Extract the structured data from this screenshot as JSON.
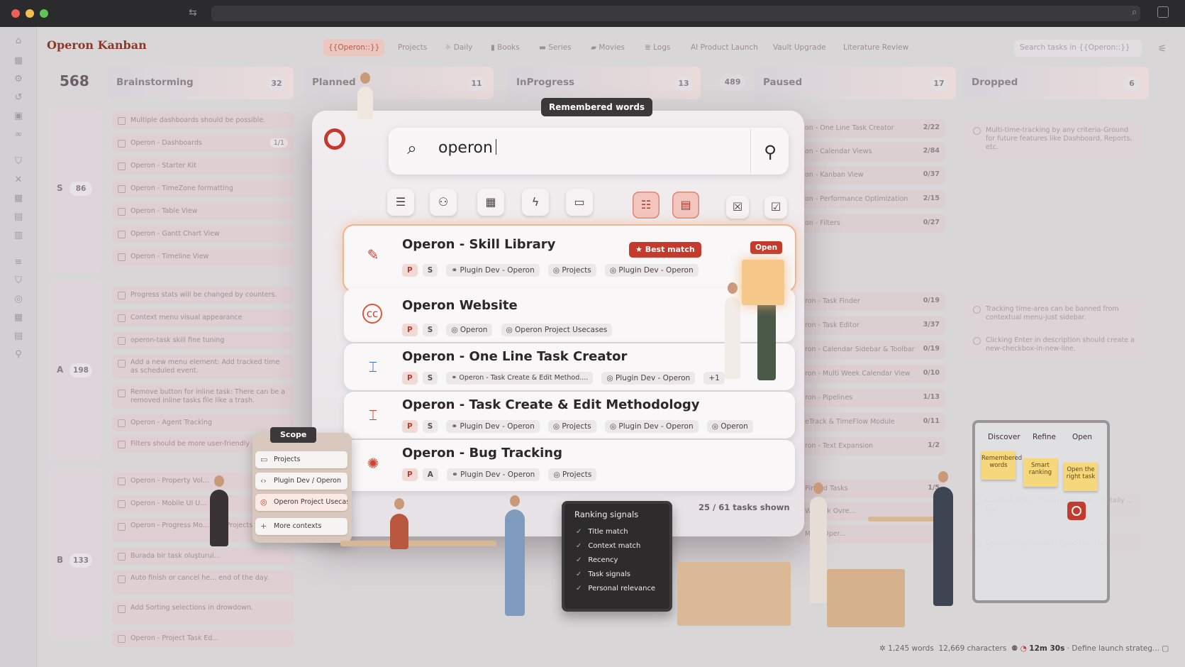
{
  "app_title": "Operon Kanban",
  "tabs": [
    {
      "label": "{{Operon::}}",
      "active": true
    },
    {
      "label": "Projects"
    },
    {
      "label": "Daily",
      "icon": "sun-icon"
    },
    {
      "label": "Books",
      "icon": "book-icon"
    },
    {
      "label": "Series",
      "icon": "tv-icon"
    },
    {
      "label": "Movies",
      "icon": "film-icon"
    },
    {
      "label": "Logs",
      "icon": "bars-icon"
    },
    {
      "label": "AI Product Launch"
    },
    {
      "label": "Vault Upgrade"
    },
    {
      "label": "Literature Review"
    }
  ],
  "search_tasks": {
    "placeholder": "Search tasks in {{Operon::}}"
  },
  "board": {
    "total": "568",
    "columns": [
      {
        "name": "Brainstorming",
        "count": "32"
      },
      {
        "name": "Planned",
        "count": "11"
      },
      {
        "name": "InProgress",
        "count": "13"
      },
      {
        "name": "Paused",
        "count": "17"
      },
      {
        "name": "Dropped",
        "count": "6"
      }
    ],
    "inprogress_badge": "489",
    "lanes": [
      {
        "name": "S",
        "count": "86"
      },
      {
        "name": "A",
        "count": "198"
      },
      {
        "name": "B",
        "count": "133"
      }
    ],
    "brainstorm_cards": [
      {
        "text": "Multiple dashboards should be possible."
      },
      {
        "text": "Operon - Dashboards",
        "progress": "1/1"
      },
      {
        "text": "Operon - Starter Kit"
      },
      {
        "text": "Operon - TimeZone formatting"
      },
      {
        "text": "Operon - Table View"
      },
      {
        "text": "Operon - Gantt Chart View"
      },
      {
        "text": "Operon - Timeline View"
      },
      {
        "text": "Progress stats will be changed by counters."
      },
      {
        "text": "Context menu visual appearance"
      },
      {
        "text": "operon-task skill fine tuning"
      },
      {
        "text": "Add a new menu element: Add tracked time as scheduled event."
      },
      {
        "text": "Remove button for inline task: There can be a removed inline tasks file like a trash."
      },
      {
        "text": "Operon - Agent Tracking"
      },
      {
        "text": "Filters should be more user-friendly"
      },
      {
        "text": "Operon - Property Vol..."
      },
      {
        "text": "Operon - Mobile UI U..."
      },
      {
        "text": "Operon - Progress Mo... and Projects"
      },
      {
        "text": "Burada bir task oluşturul..."
      },
      {
        "text": "Auto finish or cancel he... end of the day."
      },
      {
        "text": "Add Sorting selections in drowdown."
      },
      {
        "text": "Operon - Project Task Ed..."
      }
    ],
    "paused_cards": [
      {
        "text": "on - One Line Task Creator",
        "progress": "2/22"
      },
      {
        "text": "on - Calendar Views",
        "progress": "2/84"
      },
      {
        "text": "on - Kanban View",
        "progress": "0/37"
      },
      {
        "text": "on - Performance Optimization",
        "progress": "2/15"
      },
      {
        "text": "on - Filters",
        "progress": "0/27"
      },
      {
        "text": "ron - Task Finder",
        "progress": "0/19"
      },
      {
        "text": "ron - Task Editor",
        "progress": "3/37"
      },
      {
        "text": "ron - Calendar Sidebar & Toolbar",
        "progress": "0/19"
      },
      {
        "text": "ron - Multi Week Calendar View",
        "progress": "0/10"
      },
      {
        "text": "ron - Pipelines",
        "progress": "1/13"
      },
      {
        "text": "eTrack & TimeFlow Module",
        "progress": "0/11"
      },
      {
        "text": "ron - Text Expansion",
        "progress": "1/2"
      },
      {
        "text": "Pinned Tasks",
        "progress": "1/5"
      },
      {
        "text": "Wikilink Ovre..."
      },
      {
        "text": "Multi Oper..."
      }
    ],
    "dropped_cards": [
      {
        "text": "Multi-time-tracking by any criteria-Ground for future features like Dashboard, Reports, etc."
      },
      {
        "text": "Tracking time-area can be banned from contextual menu-just sidebar."
      },
      {
        "text": "Clicking Enter in description should create a new-checkbox-in-new-line."
      },
      {
        "text": "Context Task ... system preview ... totally ... try ..."
      },
      {
        "text": "Operon (Deprecated)-Sync(Ob...tion)"
      }
    ]
  },
  "palette": {
    "tooltip": "Remembered words",
    "query": "operon",
    "results": [
      {
        "title": "Operon - Skill Library",
        "icon": "magic-wand-icon",
        "tags": [
          "P",
          "S"
        ],
        "chips": [
          "Plugin Dev - Operon",
          "Projects",
          "Plugin Dev - Operon"
        ],
        "best_match": "★ Best match",
        "open": "Open"
      },
      {
        "title": "Operon Website",
        "icon": "cc-icon",
        "tags": [
          "P",
          "S"
        ],
        "chips": [
          "Operon",
          "Operon Project Usecases"
        ]
      },
      {
        "title": "Operon - One Line Task Creator",
        "icon": "text-cursor-icon",
        "tags": [
          "P",
          "S"
        ],
        "chips": [
          "Operon - Task Create & Edit Method....",
          "Plugin Dev - Operon",
          "+1"
        ]
      },
      {
        "title": "Operon - Task Create & Edit Methodology",
        "icon": "text-cursor-icon",
        "tags": [
          "P",
          "S"
        ],
        "chips": [
          "Plugin Dev - Operon",
          "Projects",
          "Plugin Dev - Operon",
          "Operon"
        ]
      },
      {
        "title": "Operon - Bug Tracking",
        "icon": "bug-icon",
        "tags": [
          "P",
          "A"
        ],
        "chips": [
          "Plugin Dev - Operon",
          "Projects"
        ]
      }
    ],
    "count_text": "25 / 61 tasks shown"
  },
  "scope": {
    "title": "Scope",
    "items": [
      "Projects",
      "Plugin Dev / Operon",
      "Operon Project Usecases",
      "More contexts"
    ]
  },
  "ranking": {
    "title": "Ranking signals",
    "items": [
      "Title match",
      "Context match",
      "Recency",
      "Task signals",
      "Personal relevance"
    ]
  },
  "whiteboard": {
    "stages": [
      "Discover",
      "Refine",
      "Open"
    ],
    "notes": [
      "Remembered words",
      "Smart ranking",
      "Open the right task"
    ]
  },
  "status": {
    "words": "1,245 words",
    "chars": "12,669 characters",
    "timer": "12m 30s",
    "task": "· Define launch strateg..."
  },
  "colors": {
    "accent": "#c43a2c",
    "highlight": "#f2b48e",
    "chrome": "#2b2a2c"
  }
}
